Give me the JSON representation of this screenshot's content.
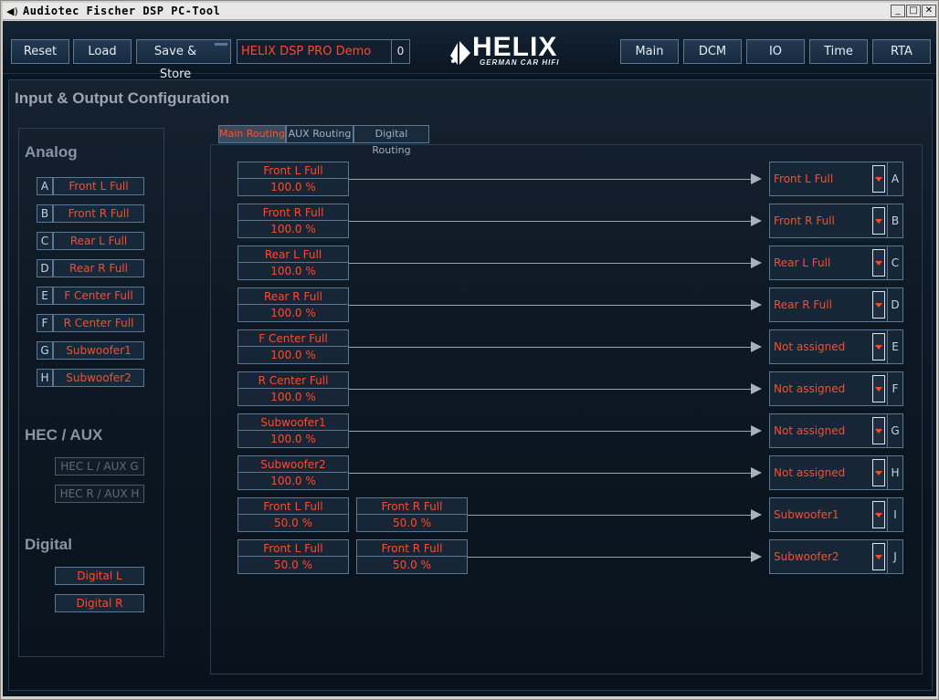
{
  "window": {
    "title": "Audiotec Fischer DSP PC-Tool",
    "min": "_",
    "max": "□",
    "close": "✕"
  },
  "toolbar": {
    "reset": "Reset",
    "load": "Load",
    "save_store": "Save & Store",
    "preset_name": "HELIX DSP PRO Demo",
    "preset_number": "0",
    "nav": [
      "Main",
      "DCM",
      "IO",
      "Time",
      "RTA"
    ]
  },
  "logo": {
    "brand": "HELIX",
    "tagline": "GERMAN CAR HIFI"
  },
  "page": {
    "title": "Input & Output Configuration"
  },
  "inputs": {
    "analog_title": "Analog",
    "analog": [
      {
        "letter": "A",
        "name": "Front L Full"
      },
      {
        "letter": "B",
        "name": "Front R Full"
      },
      {
        "letter": "C",
        "name": "Rear L Full"
      },
      {
        "letter": "D",
        "name": "Rear R Full"
      },
      {
        "letter": "E",
        "name": "F Center Full"
      },
      {
        "letter": "F",
        "name": "R Center Full"
      },
      {
        "letter": "G",
        "name": "Subwoofer1"
      },
      {
        "letter": "H",
        "name": "Subwoofer2"
      }
    ],
    "hec_title": "HEC / AUX",
    "hec": [
      "HEC L / AUX G",
      "HEC R / AUX H"
    ],
    "digital_title": "Digital",
    "digital": [
      "Digital L",
      "Digital R"
    ]
  },
  "tabs": [
    "Main Routing",
    "AUX Routing",
    "Digital Routing"
  ],
  "active_tab": "Main Routing",
  "routes": [
    {
      "sources": [
        {
          "name": "Front L Full",
          "level": "100.0 %"
        }
      ],
      "output": "Front L Full",
      "letter": "A"
    },
    {
      "sources": [
        {
          "name": "Front R Full",
          "level": "100.0 %"
        }
      ],
      "output": "Front R Full",
      "letter": "B"
    },
    {
      "sources": [
        {
          "name": "Rear L Full",
          "level": "100.0 %"
        }
      ],
      "output": "Rear L Full",
      "letter": "C"
    },
    {
      "sources": [
        {
          "name": "Rear R Full",
          "level": "100.0 %"
        }
      ],
      "output": "Rear R Full",
      "letter": "D"
    },
    {
      "sources": [
        {
          "name": "F Center Full",
          "level": "100.0 %"
        }
      ],
      "output": "Not assigned",
      "letter": "E"
    },
    {
      "sources": [
        {
          "name": "R Center Full",
          "level": "100.0 %"
        }
      ],
      "output": "Not assigned",
      "letter": "F"
    },
    {
      "sources": [
        {
          "name": "Subwoofer1",
          "level": "100.0 %"
        }
      ],
      "output": "Not assigned",
      "letter": "G"
    },
    {
      "sources": [
        {
          "name": "Subwoofer2",
          "level": "100.0 %"
        }
      ],
      "output": "Not assigned",
      "letter": "H"
    },
    {
      "sources": [
        {
          "name": "Front L Full",
          "level": "50.0 %"
        },
        {
          "name": "Front R Full",
          "level": "50.0 %"
        }
      ],
      "output": "Subwoofer1",
      "letter": "I"
    },
    {
      "sources": [
        {
          "name": "Front L Full",
          "level": "50.0 %"
        },
        {
          "name": "Front R Full",
          "level": "50.0 %"
        }
      ],
      "output": "Subwoofer2",
      "letter": "J"
    }
  ],
  "colors": {
    "accent": "#ff4a2a",
    "background": "#0a1522",
    "border": "#5a7894"
  },
  "icons": {
    "app": "speaker-icon",
    "dropdown": "triangle-down-icon",
    "route_arrow": "arrow-right-icon"
  }
}
